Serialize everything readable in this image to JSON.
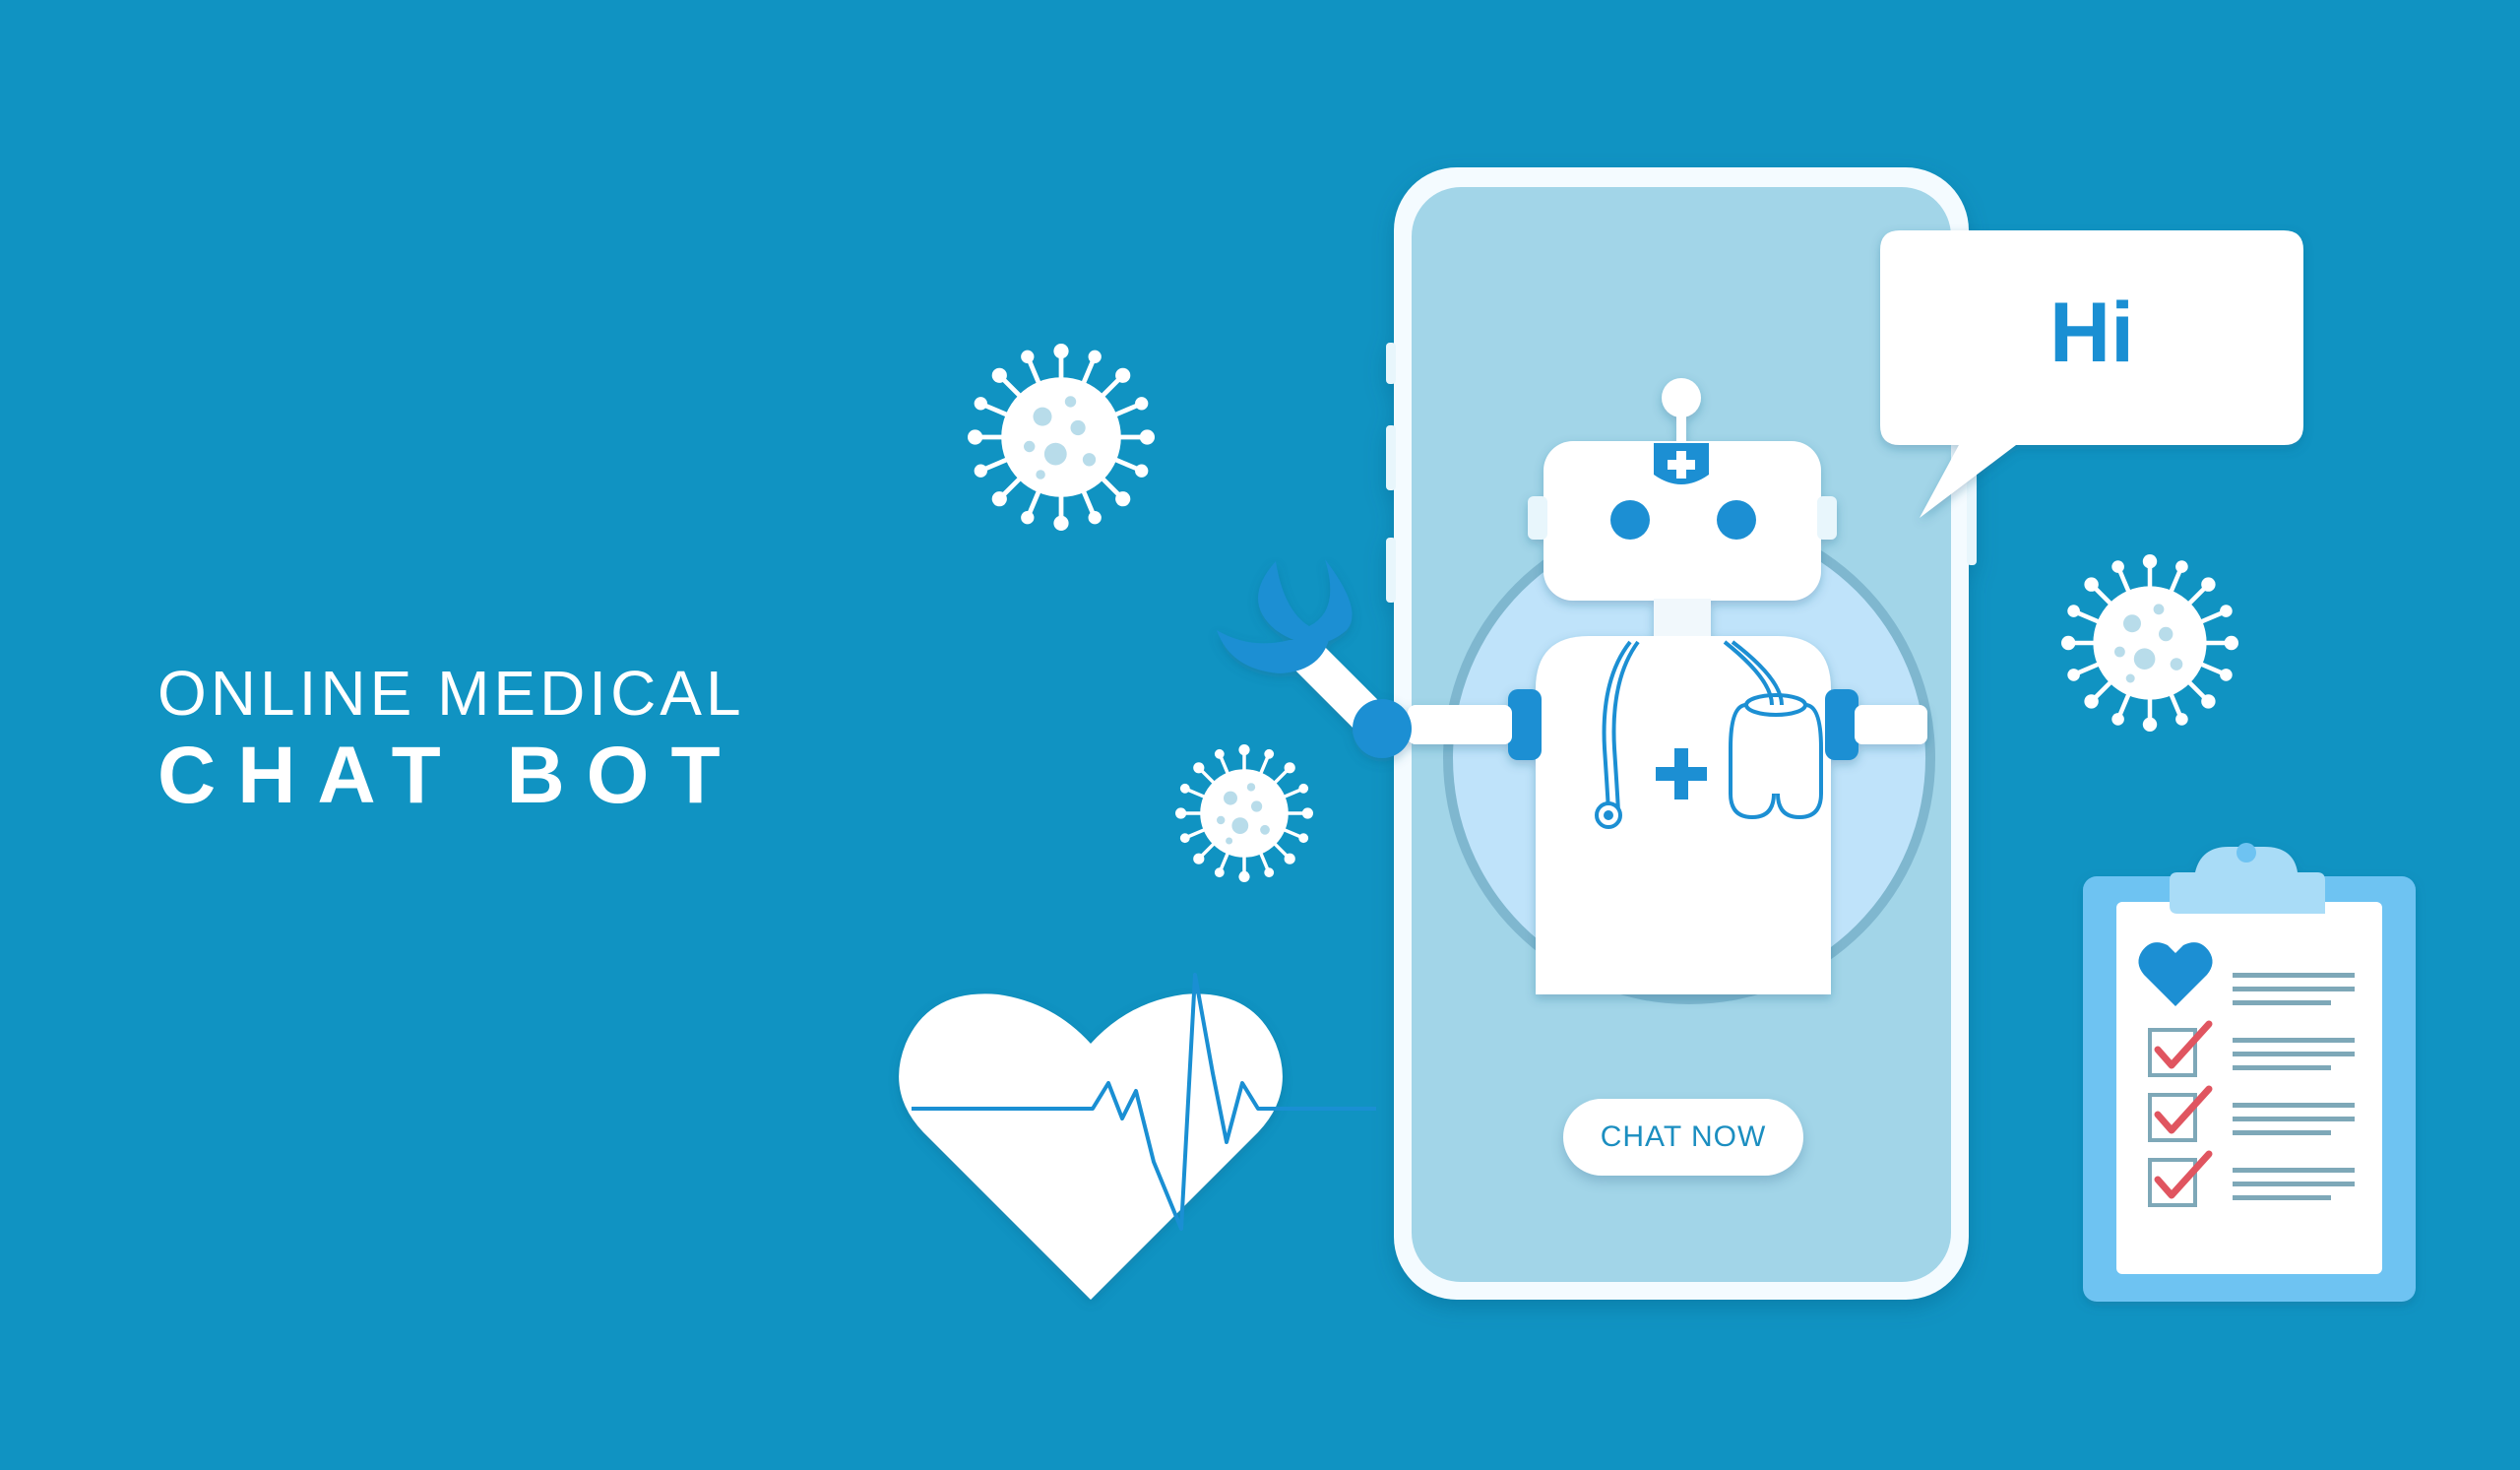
{
  "headline": {
    "line1": "ONLINE MEDICAL",
    "line2": "CHAT BOT"
  },
  "chat_bubble": {
    "text": "Hi"
  },
  "phone": {
    "button_label": "CHAT NOW"
  },
  "colors": {
    "background": "#1093c2",
    "accent_blue": "#1a8fd3",
    "screen": "#a2d5e8",
    "white": "#ffffff",
    "check_red": "#e05560"
  },
  "icons": [
    "virus-icon",
    "heart-pulse-icon",
    "robot-icon",
    "clipboard-checklist-icon",
    "stethoscope-icon",
    "speech-bubble-icon",
    "wrench-icon"
  ]
}
